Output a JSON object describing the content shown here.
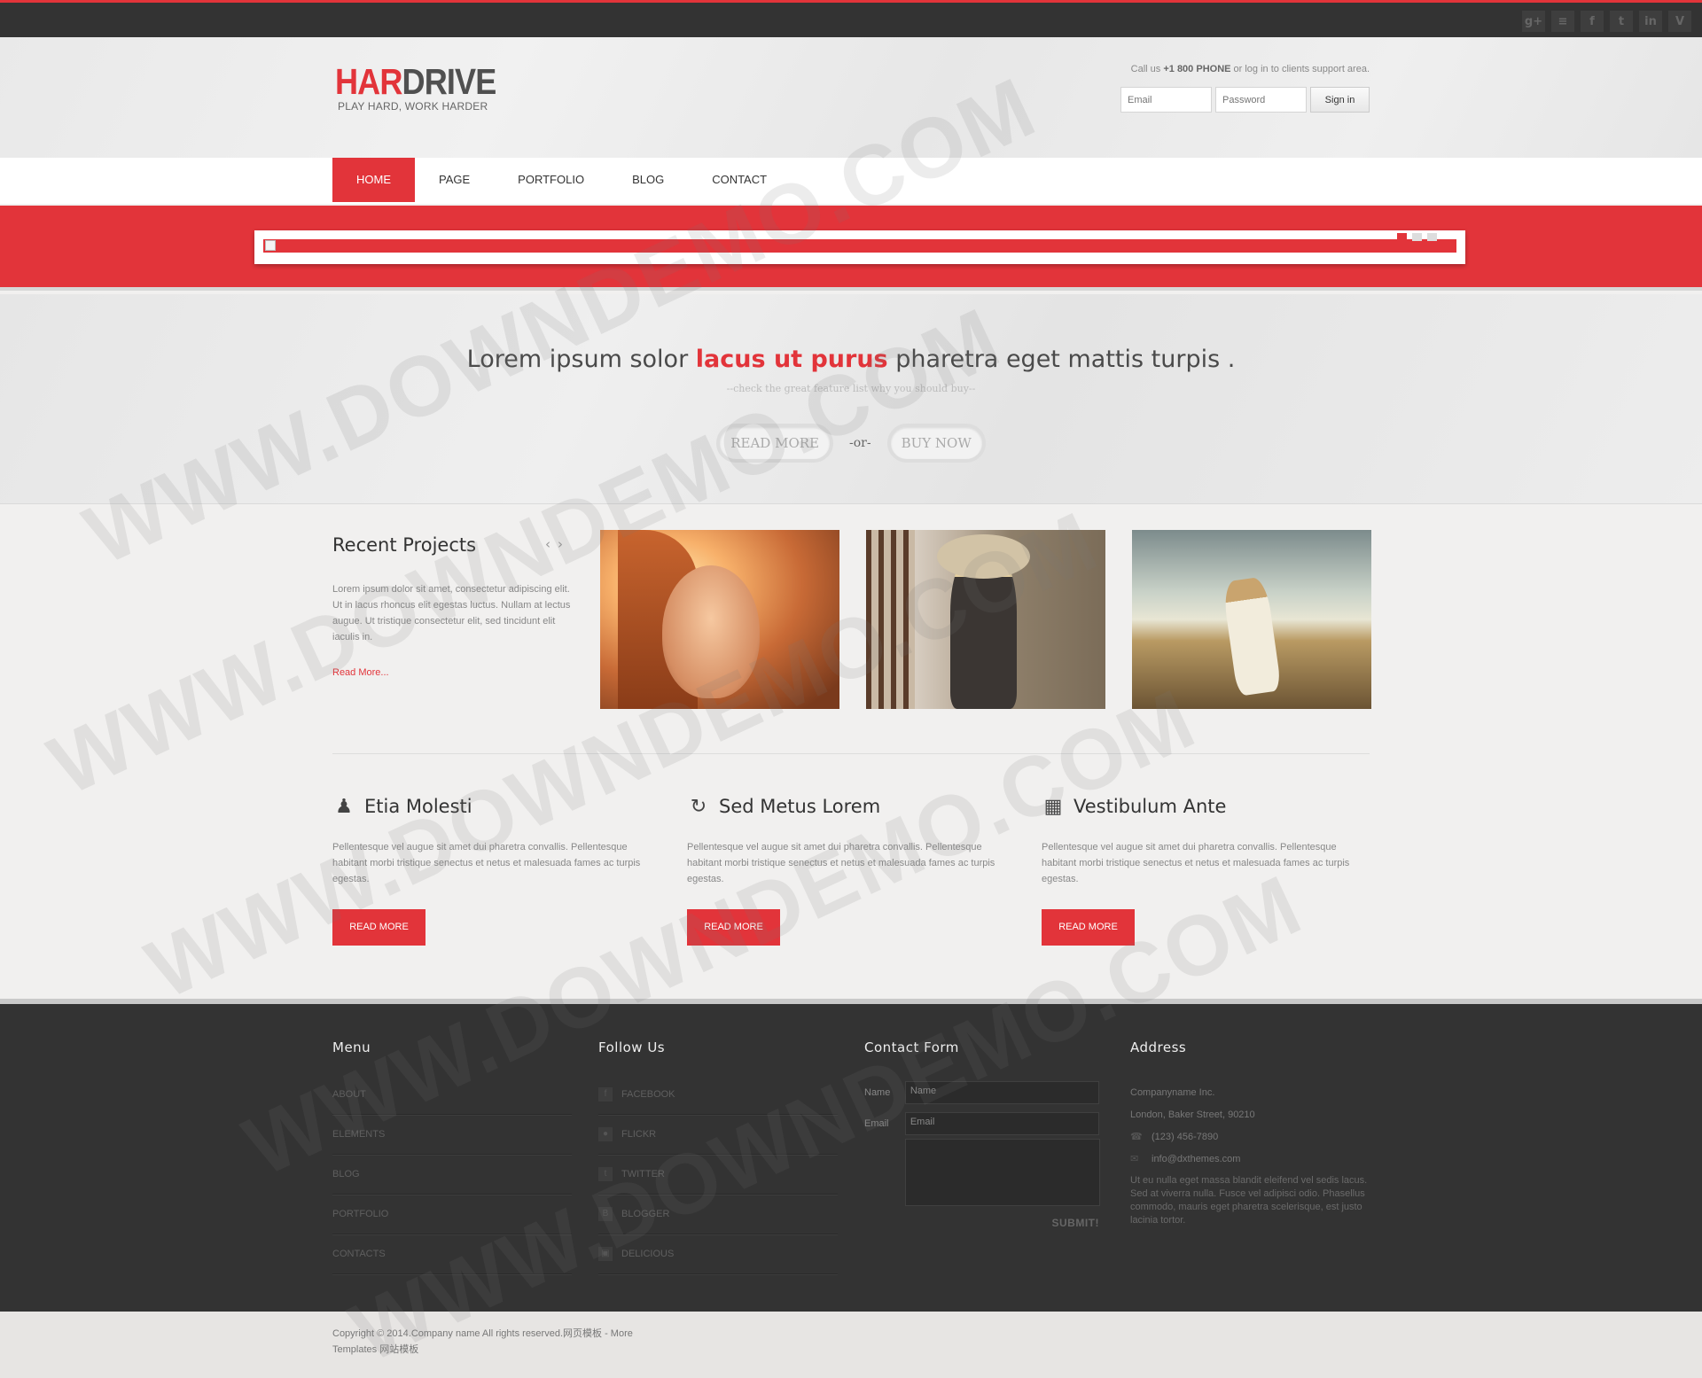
{
  "social_icons": [
    "google-plus-icon",
    "rss-icon",
    "facebook-icon",
    "twitter-icon",
    "linkedin-icon",
    "vimeo-icon"
  ],
  "social_glyphs": [
    "g+",
    "≡",
    "f",
    "t",
    "in",
    "V"
  ],
  "logo": {
    "part1": "HAR",
    "part2": "DRIVE",
    "tagline": "PLAY HARD, WORK HARDER"
  },
  "header": {
    "call_prefix": "Call us ",
    "phone": "+1 800 PHONE",
    "call_suffix": " or log in to clients support area.",
    "email_placeholder": "Email",
    "password_placeholder": "Password",
    "signin": "Sign in"
  },
  "nav": [
    "HOME",
    "PAGE",
    "PORTFOLIO",
    "BLOG",
    "CONTACT"
  ],
  "hero": {
    "text1": "Lorem ipsum solor ",
    "highlight": "lacus ut purus",
    "text2": " pharetra eget mattis turpis .",
    "sub": "--check the great feature list why you should buy--",
    "btn1": "READ MORE",
    "or": "-or-",
    "btn2": "BUY NOW"
  },
  "recent": {
    "title": "Recent Projects",
    "prev": "‹",
    "next": "›",
    "text": "Lorem ipsum dolor sit amet, consectetur adipiscing elit. Ut in lacus rhoncus elit egestas luctus. Nullam at lectus augue. Ut tristique consectetur elit, sed tincidunt elit iaculis in.",
    "more": "Read More..."
  },
  "features": [
    {
      "title": "Etia Molesti",
      "icon": "user-icon",
      "glyph": "♟",
      "text": "Pellentesque vel augue sit amet dui pharetra convallis. Pellentesque habitant morbi tristique senectus et netus et malesuada fames ac turpis egestas.",
      "button": "READ MORE"
    },
    {
      "title": "Sed Metus Lorem",
      "icon": "refresh-icon",
      "glyph": "↻",
      "text": "Pellentesque vel augue sit amet dui pharetra convallis. Pellentesque habitant morbi tristique senectus et netus et malesuada fames ac turpis egestas.",
      "button": "READ MORE"
    },
    {
      "title": "Vestibulum Ante",
      "icon": "calendar-icon",
      "glyph": "▦",
      "text": "Pellentesque vel augue sit amet dui pharetra convallis. Pellentesque habitant morbi tristique senectus et netus et malesuada fames ac turpis egestas.",
      "button": "READ MORE"
    }
  ],
  "footer": {
    "menu_title": "Menu",
    "menu": [
      "ABOUT",
      "ELEMENTS",
      "BLOG",
      "PORTFOLIO",
      "CONTACTS"
    ],
    "follow_title": "Follow Us",
    "follow": [
      {
        "label": "FACEBOOK",
        "icon": "facebook-icon",
        "glyph": "f"
      },
      {
        "label": "FLICKR",
        "icon": "flickr-icon",
        "glyph": "●"
      },
      {
        "label": "TWITTER",
        "icon": "twitter-icon",
        "glyph": "t"
      },
      {
        "label": "BLOGGER",
        "icon": "blogger-icon",
        "glyph": "B"
      },
      {
        "label": "DELICIOUS",
        "icon": "delicious-icon",
        "glyph": "▣"
      }
    ],
    "contact_title": "Contact Form",
    "name_label": "Name",
    "name_placeholder": "Name",
    "email_label": "Email",
    "email_placeholder": "Email",
    "submit": "SUBMIT!",
    "address_title": "Address",
    "company": "Companyname Inc.",
    "street": "London, Baker Street, 90210",
    "phone": "(123) 456-7890",
    "email": "info@dxthemes.com",
    "about": "Ut eu nulla eget massa blandit eleifend vel sedis lacus. Sed at viverra nulla. Fusce vel adipisci odio. Phasellus commodo, mauris eget pharetra scelerisque, est justo lacinia tortor."
  },
  "copyright": "Copyright © 2014.Company name All rights reserved.网页模板 - More Templates 网站模板",
  "watermark": "WWW.DOWNDEMO.COM",
  "colors": {
    "accent": "#e2343a",
    "dark": "#333333"
  }
}
